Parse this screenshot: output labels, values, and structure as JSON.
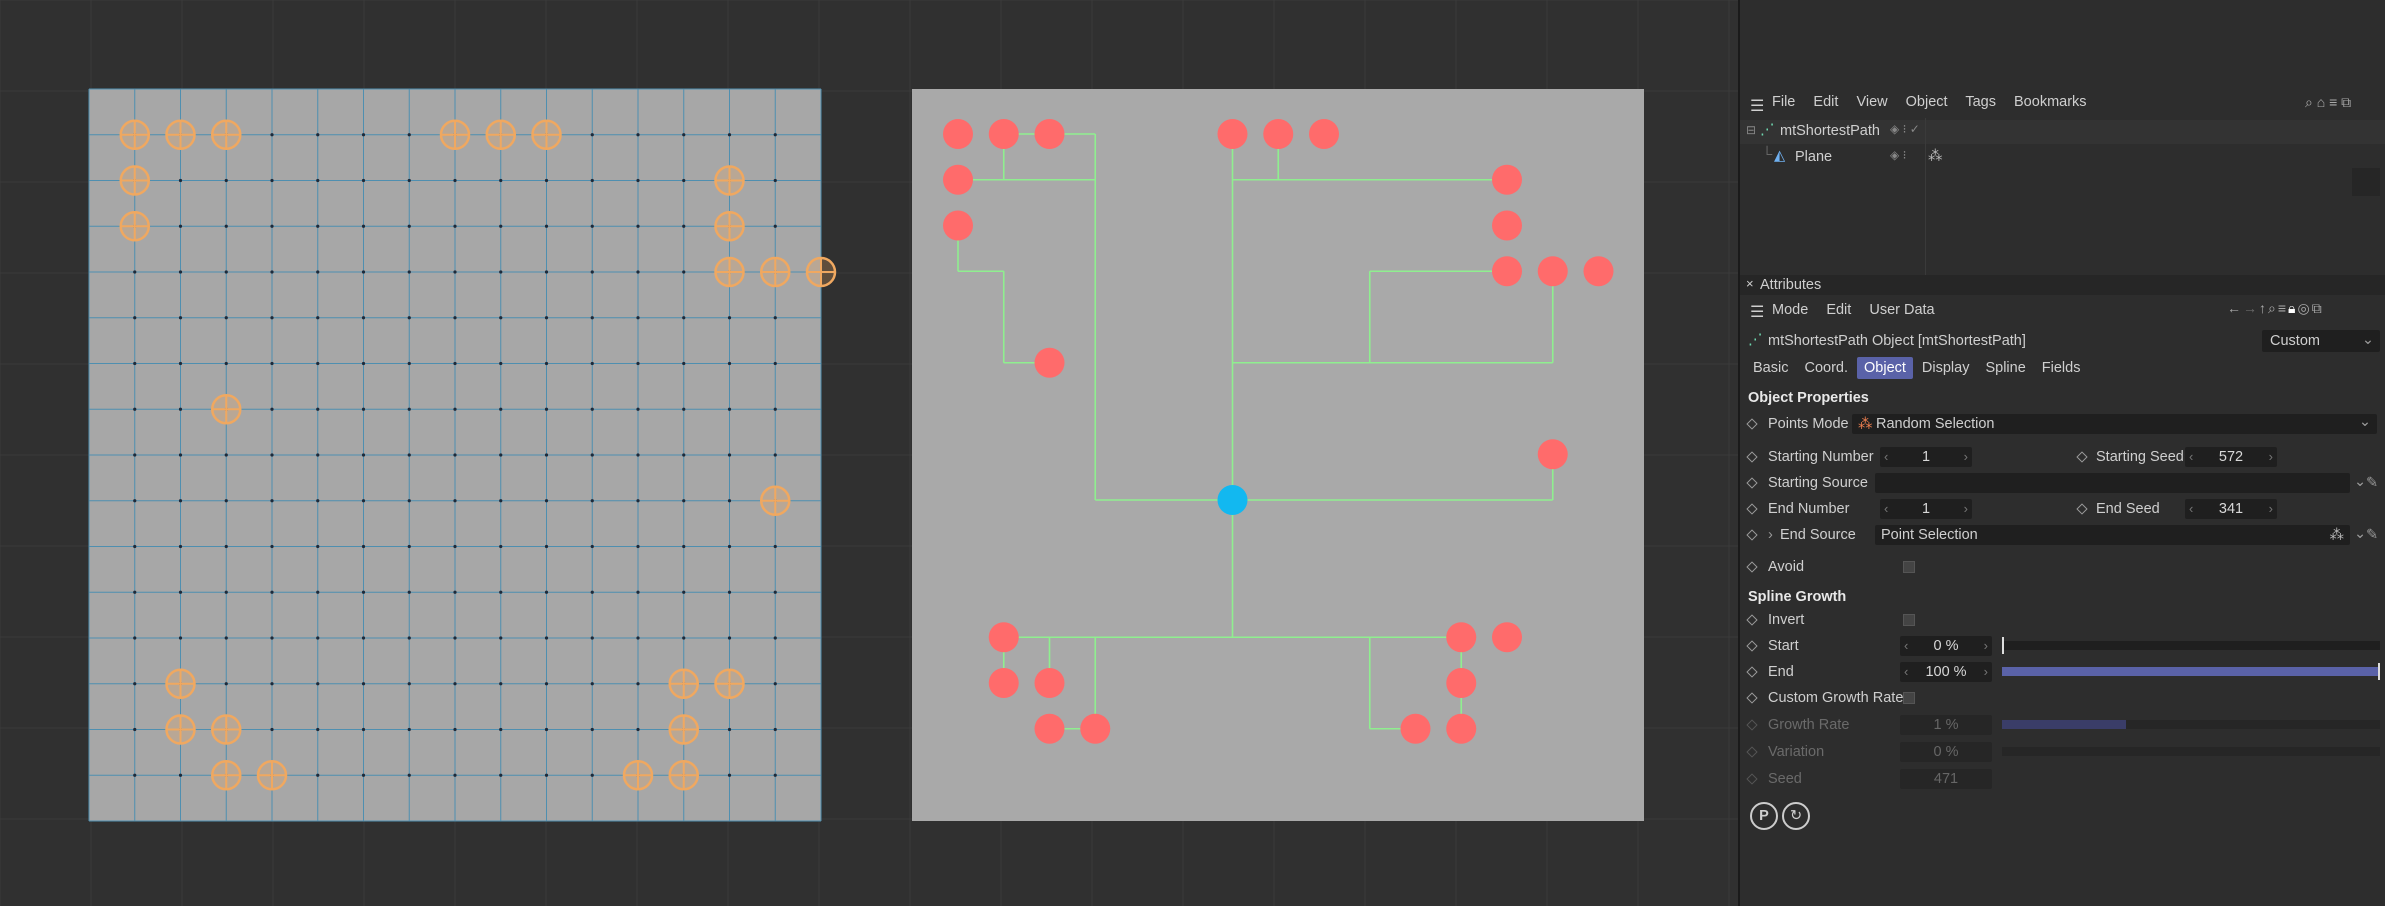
{
  "object_manager": {
    "menu": [
      "File",
      "Edit",
      "View",
      "Object",
      "Tags",
      "Bookmarks"
    ],
    "objects": [
      {
        "name": "mtShortestPath"
      },
      {
        "name": "Plane"
      }
    ]
  },
  "attributes": {
    "panel_title": "Attributes",
    "menu": [
      "Mode",
      "Edit",
      "User Data"
    ],
    "object_title": "mtShortestPath Object [mtShortestPath]",
    "preset": "Custom",
    "tabs": [
      "Basic",
      "Coord.",
      "Object",
      "Display",
      "Spline",
      "Fields"
    ],
    "selected_tab": "Object",
    "object_properties": {
      "heading": "Object Properties",
      "points_mode_label": "Points Mode",
      "points_mode_value": "Random Selection",
      "starting_number_label": "Starting Number",
      "starting_number_value": "1",
      "starting_seed_label": "Starting Seed",
      "starting_seed_value": "572",
      "starting_source_label": "Starting Source",
      "end_number_label": "End Number",
      "end_number_value": "1",
      "end_seed_label": "End Seed",
      "end_seed_value": "341",
      "end_source_label": "End Source",
      "end_source_value": "Point Selection",
      "avoid_label": "Avoid"
    },
    "spline_growth": {
      "heading": "Spline Growth",
      "invert_label": "Invert",
      "start_label": "Start",
      "start_value": "0 %",
      "start_fraction": 0,
      "end_label": "End",
      "end_value": "100 %",
      "end_fraction": 1,
      "custom_growth_label": "Custom Growth Rate",
      "growth_rate_label": "Growth Rate",
      "growth_rate_value": "1 %",
      "growth_rate_fraction": 0.01,
      "variation_label": "Variation",
      "variation_value": "0 %",
      "seed_label": "Seed",
      "seed_value": "471"
    }
  },
  "colors": {
    "accent": "#5a62a8",
    "point": "#ff6b6b",
    "start_point": "#12b8f0",
    "path_line": "#8fef8f",
    "selection_ring": "#f0a860",
    "grid_line": "#4f8fb0"
  },
  "scene": {
    "left_selected_points": [
      [
        1,
        1
      ],
      [
        2,
        1
      ],
      [
        3,
        1
      ],
      [
        8,
        1
      ],
      [
        9,
        1
      ],
      [
        10,
        1
      ],
      [
        1,
        2
      ],
      [
        1,
        3
      ],
      [
        14,
        2
      ],
      [
        14,
        3
      ],
      [
        14,
        4
      ],
      [
        15,
        4
      ],
      [
        16,
        4
      ],
      [
        3,
        7
      ],
      [
        15,
        9
      ],
      [
        2,
        13
      ],
      [
        2,
        14
      ],
      [
        3,
        14
      ],
      [
        3,
        15
      ],
      [
        4,
        15
      ],
      [
        13,
        13
      ],
      [
        14,
        13
      ],
      [
        13,
        14
      ],
      [
        12,
        15
      ],
      [
        13,
        15
      ]
    ],
    "right_end_points": [
      [
        1,
        1
      ],
      [
        2,
        1
      ],
      [
        3,
        1
      ],
      [
        7,
        1
      ],
      [
        8,
        1
      ],
      [
        9,
        1
      ],
      [
        1,
        2
      ],
      [
        1,
        3
      ],
      [
        3,
        6
      ],
      [
        13,
        2
      ],
      [
        13,
        3
      ],
      [
        13,
        4
      ],
      [
        14,
        4
      ],
      [
        15,
        4
      ],
      [
        14,
        8
      ],
      [
        2,
        12
      ],
      [
        2,
        13
      ],
      [
        3,
        13
      ],
      [
        3,
        14
      ],
      [
        4,
        14
      ],
      [
        12,
        12
      ],
      [
        13,
        12
      ],
      [
        12,
        13
      ],
      [
        11,
        14
      ],
      [
        12,
        14
      ]
    ],
    "right_start_point": [
      7,
      9
    ],
    "right_paths": [
      [
        [
          7,
          9
        ],
        [
          7,
          1
        ]
      ],
      [
        [
          7,
          2
        ],
        [
          13,
          2
        ]
      ],
      [
        [
          8,
          1
        ],
        [
          8,
          2
        ]
      ],
      [
        [
          7,
          6
        ],
        [
          14,
          6
        ]
      ],
      [
        [
          14,
          6
        ],
        [
          14,
          4
        ]
      ],
      [
        [
          10,
          6
        ],
        [
          10,
          4
        ]
      ],
      [
        [
          10,
          4
        ],
        [
          13,
          4
        ]
      ],
      [
        [
          7,
          9
        ],
        [
          14,
          9
        ]
      ],
      [
        [
          14,
          9
        ],
        [
          14,
          8
        ]
      ],
      [
        [
          7,
          9
        ],
        [
          4,
          9
        ]
      ],
      [
        [
          4,
          9
        ],
        [
          4,
          1
        ]
      ],
      [
        [
          4,
          1
        ],
        [
          2,
          1
        ]
      ],
      [
        [
          4,
          2
        ],
        [
          1,
          2
        ]
      ],
      [
        [
          2,
          1
        ],
        [
          2,
          2
        ]
      ],
      [
        [
          1,
          3
        ],
        [
          1,
          4
        ]
      ],
      [
        [
          1,
          4
        ],
        [
          2,
          4
        ]
      ],
      [
        [
          2,
          4
        ],
        [
          2,
          6
        ]
      ],
      [
        [
          2,
          6
        ],
        [
          3,
          6
        ]
      ],
      [
        [
          7,
          9
        ],
        [
          7,
          12
        ]
      ],
      [
        [
          2,
          12
        ],
        [
          12,
          12
        ]
      ],
      [
        [
          2,
          12
        ],
        [
          2,
          13
        ]
      ],
      [
        [
          3,
          12
        ],
        [
          3,
          13
        ]
      ],
      [
        [
          4,
          12
        ],
        [
          4,
          14
        ]
      ],
      [
        [
          3,
          14
        ],
        [
          4,
          14
        ]
      ],
      [
        [
          12,
          12
        ],
        [
          12,
          14
        ]
      ],
      [
        [
          10,
          12
        ],
        [
          10,
          14
        ]
      ],
      [
        [
          10,
          14
        ],
        [
          11,
          14
        ]
      ]
    ]
  }
}
